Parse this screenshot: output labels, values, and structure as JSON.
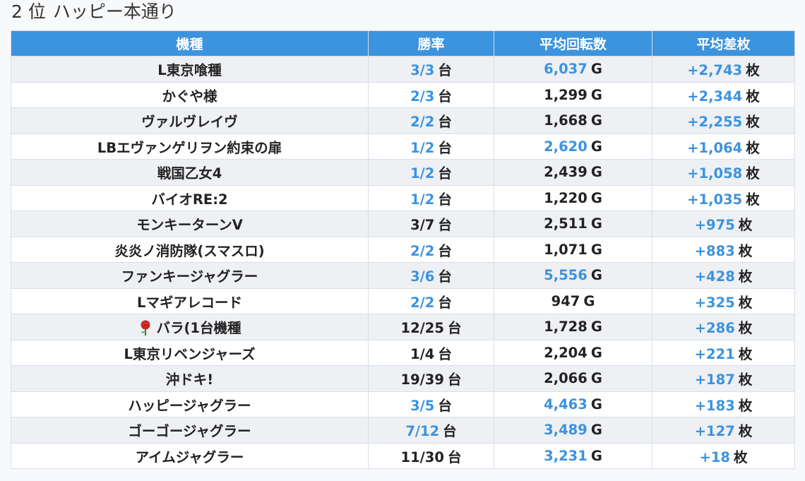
{
  "page": {
    "rank_label": "2 位",
    "store_name": "ハッピー本通り"
  },
  "table": {
    "headers": [
      "機種",
      "勝率",
      "平均回転数",
      "平均差枚"
    ],
    "rows": [
      {
        "machine": "L東京喰種",
        "icon": "",
        "win": "3/3",
        "win_hl": true,
        "spins": "6,037",
        "spins_hl": true,
        "diff": "+2,743",
        "diff_hl": true
      },
      {
        "machine": "かぐや様",
        "icon": "",
        "win": "2/3",
        "win_hl": true,
        "spins": "1,299",
        "spins_hl": false,
        "diff": "+2,344",
        "diff_hl": true
      },
      {
        "machine": "ヴァルヴレイヴ",
        "icon": "",
        "win": "2/2",
        "win_hl": true,
        "spins": "1,668",
        "spins_hl": false,
        "diff": "+2,255",
        "diff_hl": true
      },
      {
        "machine": "LBエヴァンゲリヲン約束の扉",
        "icon": "",
        "win": "1/2",
        "win_hl": true,
        "spins": "2,620",
        "spins_hl": true,
        "diff": "+1,064",
        "diff_hl": true
      },
      {
        "machine": "戦国乙女4",
        "icon": "",
        "win": "1/2",
        "win_hl": true,
        "spins": "2,439",
        "spins_hl": false,
        "diff": "+1,058",
        "diff_hl": true
      },
      {
        "machine": "バイオRE:2",
        "icon": "",
        "win": "1/2",
        "win_hl": true,
        "spins": "1,220",
        "spins_hl": false,
        "diff": "+1,035",
        "diff_hl": true
      },
      {
        "machine": "モンキーターンV",
        "icon": "",
        "win": "3/7",
        "win_hl": false,
        "spins": "2,511",
        "spins_hl": false,
        "diff": "+975",
        "diff_hl": true
      },
      {
        "machine": "炎炎ノ消防隊(スマスロ)",
        "icon": "",
        "win": "2/2",
        "win_hl": true,
        "spins": "1,071",
        "spins_hl": false,
        "diff": "+883",
        "diff_hl": true
      },
      {
        "machine": "ファンキージャグラー",
        "icon": "",
        "win": "3/6",
        "win_hl": true,
        "spins": "5,556",
        "spins_hl": true,
        "diff": "+428",
        "diff_hl": true
      },
      {
        "machine": "Lマギアレコード",
        "icon": "",
        "win": "2/2",
        "win_hl": true,
        "spins": "947",
        "spins_hl": false,
        "diff": "+325",
        "diff_hl": true
      },
      {
        "machine": "バラ(1台機種",
        "icon": "rose-icon",
        "win": "12/25",
        "win_hl": false,
        "spins": "1,728",
        "spins_hl": false,
        "diff": "+286",
        "diff_hl": true
      },
      {
        "machine": "L東京リベンジャーズ",
        "icon": "",
        "win": "1/4",
        "win_hl": false,
        "spins": "2,204",
        "spins_hl": false,
        "diff": "+221",
        "diff_hl": true
      },
      {
        "machine": "沖ドキ!",
        "icon": "",
        "win": "19/39",
        "win_hl": false,
        "spins": "2,066",
        "spins_hl": false,
        "diff": "+187",
        "diff_hl": true
      },
      {
        "machine": "ハッピージャグラー",
        "icon": "",
        "win": "3/5",
        "win_hl": true,
        "spins": "4,463",
        "spins_hl": true,
        "diff": "+183",
        "diff_hl": true
      },
      {
        "machine": "ゴーゴージャグラー",
        "icon": "",
        "win": "7/12",
        "win_hl": true,
        "spins": "3,489",
        "spins_hl": true,
        "diff": "+127",
        "diff_hl": true
      },
      {
        "machine": "アイムジャグラー",
        "icon": "",
        "win": "11/30",
        "win_hl": false,
        "spins": "3,231",
        "spins_hl": true,
        "diff": "+18",
        "diff_hl": true
      }
    ],
    "units": {
      "win": "台",
      "spins": "G",
      "diff": "枚"
    }
  },
  "colors": {
    "header_bg": "#3c93de",
    "highlight_text": "#3c93de",
    "row_alt_bg": "#eef0f3"
  }
}
